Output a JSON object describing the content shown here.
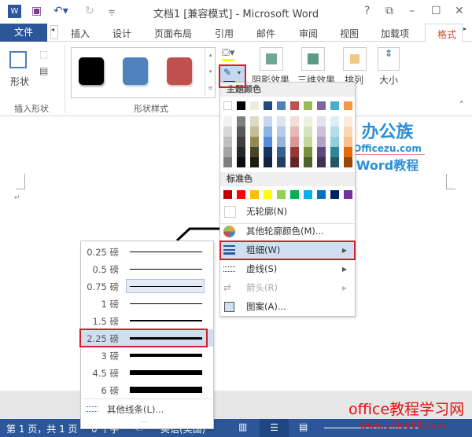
{
  "title_bar": {
    "title": "文档1 [兼容模式] - Microsoft Word",
    "help": "?",
    "restore": "⧉",
    "minimize": "–",
    "maximize": "☐",
    "close": "✕"
  },
  "tabs": [
    "文件",
    "插入",
    "设计",
    "页面布局",
    "引用",
    "邮件",
    "审阅",
    "视图",
    "加载项",
    "格式"
  ],
  "ribbon": {
    "insert_shapes_group": "插入形状",
    "shapes_button": "形状",
    "shape_styles_group": "形状样式",
    "style_swatches": [
      "#000000",
      "#4f81bd",
      "#c0504d"
    ],
    "shadow": "阴影效果",
    "threed": "三维效果",
    "arrange": "排列",
    "size": "大小"
  },
  "outline_menu": {
    "theme_colors_header": "主题颜色",
    "theme_colors": [
      "#ffffff",
      "#000000",
      "#eeece1",
      "#1f497d",
      "#4f81bd",
      "#c0504d",
      "#9bbb59",
      "#8064a2",
      "#4bacc6",
      "#f79646"
    ],
    "theme_shades": [
      [
        "#f2f2f2",
        "#d8d8d8",
        "#bfbfbf",
        "#a5a5a5",
        "#7f7f7f"
      ],
      [
        "#7f7f7f",
        "#595959",
        "#3f3f3f",
        "#262626",
        "#0c0c0c"
      ],
      [
        "#ddd9c3",
        "#c4bd97",
        "#938953",
        "#494429",
        "#1d1b10"
      ],
      [
        "#c6d9f0",
        "#8db3e2",
        "#548dd4",
        "#17365d",
        "#0f243e"
      ],
      [
        "#dbe5f1",
        "#b8cce4",
        "#95b3d7",
        "#366092",
        "#244061"
      ],
      [
        "#f2dcdb",
        "#e5b9b7",
        "#d99694",
        "#953734",
        "#632423"
      ],
      [
        "#ebf1dd",
        "#d7e3bc",
        "#c3d69b",
        "#76923c",
        "#4f6128"
      ],
      [
        "#e5e0ec",
        "#ccc1d9",
        "#b2a2c7",
        "#5f497a",
        "#3f3151"
      ],
      [
        "#dbeef3",
        "#b7dde8",
        "#92cddc",
        "#31859b",
        "#205867"
      ],
      [
        "#fdeada",
        "#fbd5b5",
        "#fac08f",
        "#e36c09",
        "#974806"
      ]
    ],
    "standard_header": "标准色",
    "standard_colors": [
      "#c00000",
      "#ff0000",
      "#ffc000",
      "#ffff00",
      "#92d050",
      "#00b050",
      "#00b0f0",
      "#0070c0",
      "#002060",
      "#7030a0"
    ],
    "items": [
      "无轮廓(N)",
      "其他轮廓颜色(M)...",
      "粗细(W)",
      "虚线(S)",
      "箭头(R)",
      "图案(A)..."
    ]
  },
  "weight_menu": {
    "items": [
      {
        "label": "0.25 磅",
        "pt": 0.25
      },
      {
        "label": "0.5 磅",
        "pt": 0.5
      },
      {
        "label": "0.75 磅",
        "pt": 0.75
      },
      {
        "label": "1 磅",
        "pt": 1
      },
      {
        "label": "1.5 磅",
        "pt": 1.5
      },
      {
        "label": "2.25 磅",
        "pt": 2.25
      },
      {
        "label": "3 磅",
        "pt": 3
      },
      {
        "label": "4.5 磅",
        "pt": 4.5
      },
      {
        "label": "6 磅",
        "pt": 6
      }
    ],
    "selected": "2.25 磅",
    "more": "其他线条(L)..."
  },
  "status_bar": {
    "page": "第 1 页，共 1 页",
    "words": "0 个字",
    "language": "英语(美国)"
  },
  "watermarks": {
    "logo": "办公族",
    "logo_url": "Officezu.com",
    "logo_sub": "Word教程",
    "site": "office教程学习网",
    "site_url": "www.office68.com"
  }
}
